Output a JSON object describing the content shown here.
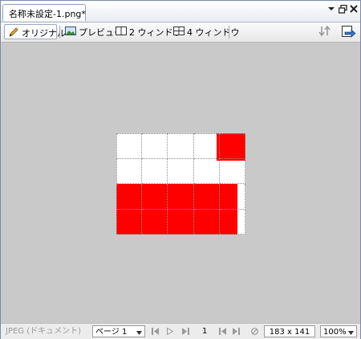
{
  "document_tab": {
    "title": "名称未設定-1.png*"
  },
  "window_controls": {
    "menu": "▾",
    "restore": "🗗",
    "close": "✕"
  },
  "view_tabs": [
    {
      "label": "オリジナル",
      "icon": "pencil-icon"
    },
    {
      "label": "プレビュー",
      "icon": "image-icon"
    },
    {
      "label": "2 ウィンドウ",
      "icon": "split-2-icon"
    },
    {
      "label": "4 ウィンドウ",
      "icon": "split-4-icon"
    }
  ],
  "canvas": {
    "image_colors": {
      "fill": "#fe0000",
      "background": "#ffffff"
    },
    "workspace_color": "#c9c9c9"
  },
  "statusbar": {
    "format": "JPEG (ドキュメント)",
    "page_select": "ページ 1",
    "page_number": "1",
    "dimensions": "183 x 141",
    "zoom": "100%"
  }
}
